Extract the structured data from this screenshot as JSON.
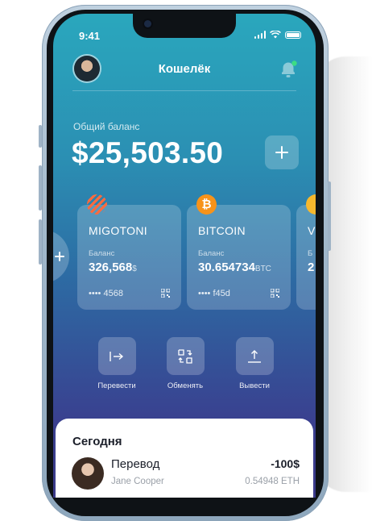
{
  "status_bar": {
    "time": "9:41"
  },
  "header": {
    "title": "Кошелёк"
  },
  "balance": {
    "label": "Общий баланс",
    "value": "$25,503.50"
  },
  "cards": [
    {
      "name": "MIGOTONI",
      "balance_label": "Баланс",
      "amount": "326,568",
      "unit": "$",
      "number": "•••• 4568",
      "icon": "migotoni-logo-icon"
    },
    {
      "name": "BITCOIN",
      "balance_label": "Баланс",
      "amount": "30.654734",
      "unit": "BTC",
      "number": "•••• f45d",
      "icon": "bitcoin-icon",
      "icon_glyph": "₿"
    },
    {
      "name": "V",
      "balance_label": "Б",
      "amount": "2",
      "icon": "coin-icon"
    }
  ],
  "actions": [
    {
      "label": "Перевести",
      "icon": "transfer-icon"
    },
    {
      "label": "Обменять",
      "icon": "exchange-icon"
    },
    {
      "label": "Вывести",
      "icon": "withdraw-icon"
    }
  ],
  "transactions": {
    "section_title": "Сегодня",
    "items": [
      {
        "title": "Перевод",
        "name": "Jane Cooper",
        "amount": "-100$",
        "crypto_amount": "0.54948 ETH"
      }
    ]
  },
  "colors": {
    "accent_teal": "#2aa7bd",
    "accent_indigo": "#3b3a8a",
    "bitcoin": "#f7931a",
    "notification_dot": "#3ddc84"
  }
}
